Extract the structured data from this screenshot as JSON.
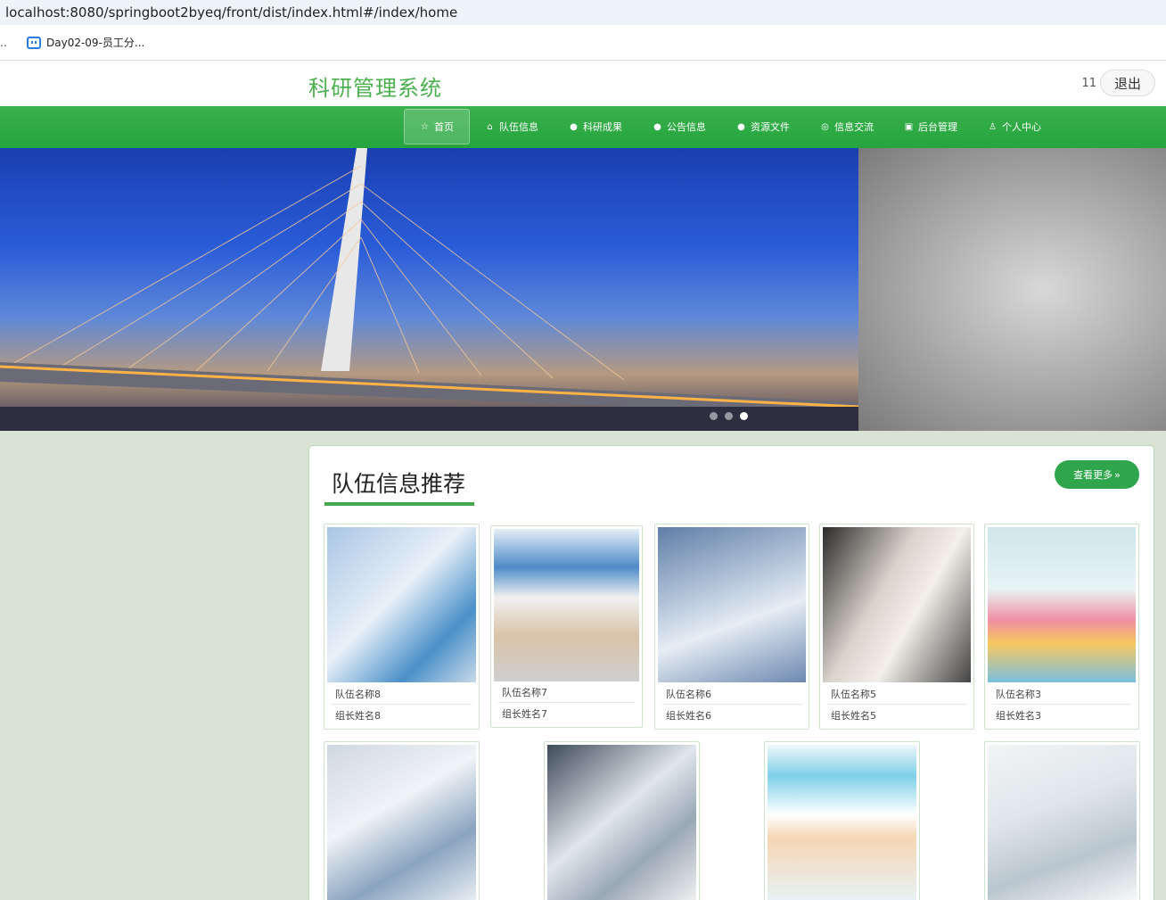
{
  "browser": {
    "url": "localhost:8080/springboot2byeq/front/dist/index.html#/index/home",
    "bookmark_overflow": "..",
    "bookmark_label": "Day02-09-员工分..."
  },
  "header": {
    "site_title": "科研管理系统",
    "user_name": "11",
    "logout_label": "退出"
  },
  "nav": {
    "items": [
      {
        "label": "首页",
        "icon": "star-icon"
      },
      {
        "label": "队伍信息",
        "icon": "bag-icon"
      },
      {
        "label": "科研成果",
        "icon": "info-icon"
      },
      {
        "label": "公告信息",
        "icon": "question-icon"
      },
      {
        "label": "资源文件",
        "icon": "info-icon"
      },
      {
        "label": "信息交流",
        "icon": "chat-icon"
      },
      {
        "label": "后台管理",
        "icon": "briefcase-icon"
      },
      {
        "label": "个人中心",
        "icon": "user-icon"
      }
    ]
  },
  "section": {
    "title": "队伍信息推荐",
    "more_label": "查看更多"
  },
  "cards": [
    {
      "name": "队伍名称8",
      "leader": "组长姓名8"
    },
    {
      "name": "队伍名称7",
      "leader": "组长姓名7"
    },
    {
      "name": "队伍名称6",
      "leader": "组长姓名6"
    },
    {
      "name": "队伍名称5",
      "leader": "组长姓名5"
    },
    {
      "name": "队伍名称3",
      "leader": "组长姓名3"
    }
  ]
}
